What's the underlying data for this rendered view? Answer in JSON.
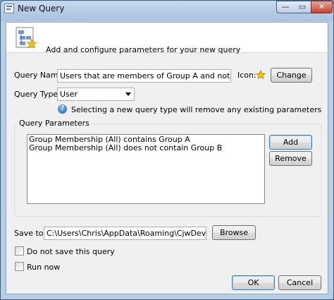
{
  "window": {
    "title": "New Query",
    "controls": {
      "minimize": "—",
      "maximize": "▭",
      "close": "✕"
    }
  },
  "header": {
    "text": "Add and configure parameters for your new query",
    "icon": "query-with-star-icon"
  },
  "query_name": {
    "label": "Query Name:",
    "value": "Users that are members of Group A and not Group B"
  },
  "icon_field": {
    "label": "Icon:",
    "icon": "star-icon",
    "change_label": "Change"
  },
  "query_type": {
    "label": "Query Type:",
    "selected": "User",
    "info_text": "Selecting a new query type will remove any existing parameters"
  },
  "parameters": {
    "group_title": "Query Parameters",
    "items": [
      "Group Membership (All) contains Group A",
      "Group Membership (All) does not contain Group B"
    ],
    "add_label": "Add",
    "remove_label": "Remove"
  },
  "save_to": {
    "label": "Save to:",
    "value": "C:\\Users\\Chris\\AppData\\Roaming\\CjwDev\\ADInfo\\Quer",
    "browse_label": "Browse"
  },
  "options": {
    "do_not_save": {
      "label": "Do not save this query",
      "checked": false
    },
    "run_now": {
      "label": "Run now",
      "checked": false
    }
  },
  "footer": {
    "ok_label": "OK",
    "cancel_label": "Cancel"
  },
  "colors": {
    "titlebar": "#a9c2de",
    "dialog_bg": "#f0f0f0",
    "star": "#f5c400"
  }
}
